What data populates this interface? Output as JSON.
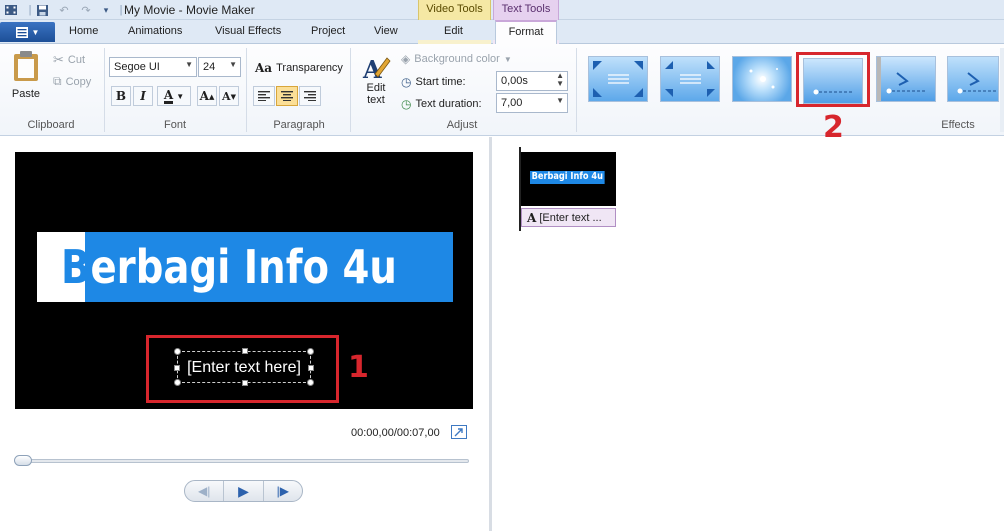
{
  "window": {
    "title": "My Movie - Movie Maker"
  },
  "context_tabs": {
    "video_tools": "Video Tools",
    "text_tools": "Text Tools"
  },
  "tabs": {
    "home": "Home",
    "animations": "Animations",
    "visual_effects": "Visual Effects",
    "project": "Project",
    "view": "View",
    "edit": "Edit",
    "format": "Format",
    "active": "Format"
  },
  "ribbon": {
    "clipboard": {
      "label": "Clipboard",
      "paste": "Paste",
      "cut": "Cut",
      "copy": "Copy"
    },
    "font": {
      "label": "Font",
      "family": "Segoe UI",
      "size": "24",
      "bold": "B",
      "italic": "I",
      "color": "A",
      "grow": "A",
      "shrink": "A"
    },
    "paragraph": {
      "label": "Paragraph",
      "transparency": "Transparency",
      "active_alignment": "center"
    },
    "adjust": {
      "label": "Adjust",
      "edit_text_line1": "Edit",
      "edit_text_line2": "text",
      "background_color": "Background color",
      "start_time_label": "Start time:",
      "start_time_value": "0,00s",
      "text_duration_label": "Text duration:",
      "text_duration_value": "7,00"
    },
    "effects": {
      "label": "Effects",
      "selected_index": 3,
      "count": 7
    }
  },
  "preview": {
    "title_text": "Berbagi Info 4u",
    "title_first_letter": "B",
    "title_rest": "erbagi Info 4u",
    "caption_placeholder": "[Enter text here]",
    "timecode": "00:00,00/00:07,00"
  },
  "storyboard": {
    "clip_title": "Berbagi Info 4u",
    "caption": "[Enter text ..."
  },
  "annotations": {
    "marker_1": "1",
    "marker_2": "2"
  },
  "colors": {
    "title_band": "#1e88e5",
    "highlight_red": "#d7262d",
    "text_tools_tab": "#e6d1ef",
    "video_tools_tab": "#f5e8a4"
  }
}
